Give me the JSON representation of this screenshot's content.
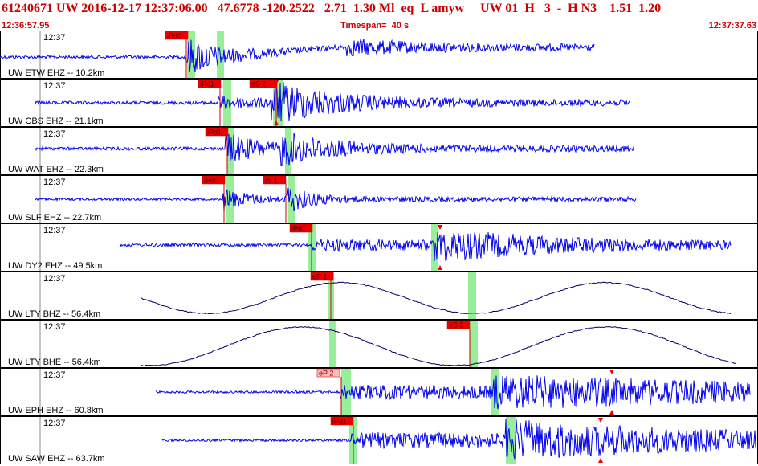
{
  "header": {
    "title": "61240671 UW 2016-12-17 12:37:06.00   47.6778 -120.2522   2.71  1.30 Ml  eq  L amyw     UW 01  H   3  -  H N3    1.51  1.20",
    "start_time": "12:36:57.95",
    "timespan": "Timespan=  40 s",
    "end_time": "12:37:37.63"
  },
  "colors": {
    "trace": "#0000ee",
    "smooth_trace": "#000066",
    "pick_fill": "#ee0000",
    "pick_fill_light": "#ffbbbb",
    "pick_line": "#cc0000",
    "window": "#99ee99",
    "tick": "#888888",
    "grid": "#000000"
  },
  "traces": [
    {
      "label": "UW ETW EHZ -- 10.2km",
      "time_tick": "12:37",
      "kind": "noise",
      "picks": [
        {
          "label": "iPd0",
          "style": "solid"
        }
      ],
      "amplitude_markers": []
    },
    {
      "label": "UW CBS EHZ -- 21.1km",
      "time_tick": "12:37",
      "kind": "noise",
      "picks": [
        {
          "label": "iPd1",
          "style": "solid"
        },
        {
          "label": "eS 2",
          "style": "solid"
        }
      ],
      "amplitude_markers": [
        "top",
        "bottom"
      ]
    },
    {
      "label": "UW WAT EHZ -- 22.3km",
      "time_tick": "12:37",
      "kind": "noise",
      "picks": [
        {
          "label": "iPd1",
          "style": "solid"
        }
      ],
      "amplitude_markers": []
    },
    {
      "label": "UW SLF EHZ -- 22.7km",
      "time_tick": "12:37",
      "kind": "noise",
      "picks": [
        {
          "label": "iPd0",
          "style": "solid"
        },
        {
          "label": "iS 1",
          "style": "solid"
        }
      ],
      "amplitude_markers": []
    },
    {
      "label": "UW DY2 EHZ -- 49.5km",
      "time_tick": "12:37",
      "kind": "noise",
      "picks": [
        {
          "label": "iPd1",
          "style": "solid"
        }
      ],
      "amplitude_markers": [
        "top",
        "bottom"
      ]
    },
    {
      "label": "UW LTY BHZ -- 56.4km",
      "time_tick": "12:37",
      "kind": "smooth",
      "picks": [
        {
          "label": "eP 1",
          "style": "solid"
        }
      ],
      "amplitude_markers": []
    },
    {
      "label": "UW LTY BHE -- 56.4km",
      "time_tick": "12:37",
      "kind": "smooth",
      "picks": [
        {
          "label": "eS 2",
          "style": "solid"
        }
      ],
      "amplitude_markers": []
    },
    {
      "label": "UW EPH EHZ -- 60.8km",
      "time_tick": "12:37",
      "kind": "noise",
      "picks": [
        {
          "label": "eP 2",
          "style": "light"
        }
      ],
      "amplitude_markers": [
        "top",
        "bottom"
      ]
    },
    {
      "label": "UW SAW EHZ -- 63.7km",
      "time_tick": "12:37",
      "kind": "noise",
      "picks": [
        {
          "label": "iPd1",
          "style": "solid"
        }
      ],
      "amplitude_markers": [
        "top",
        "bottom"
      ]
    }
  ]
}
